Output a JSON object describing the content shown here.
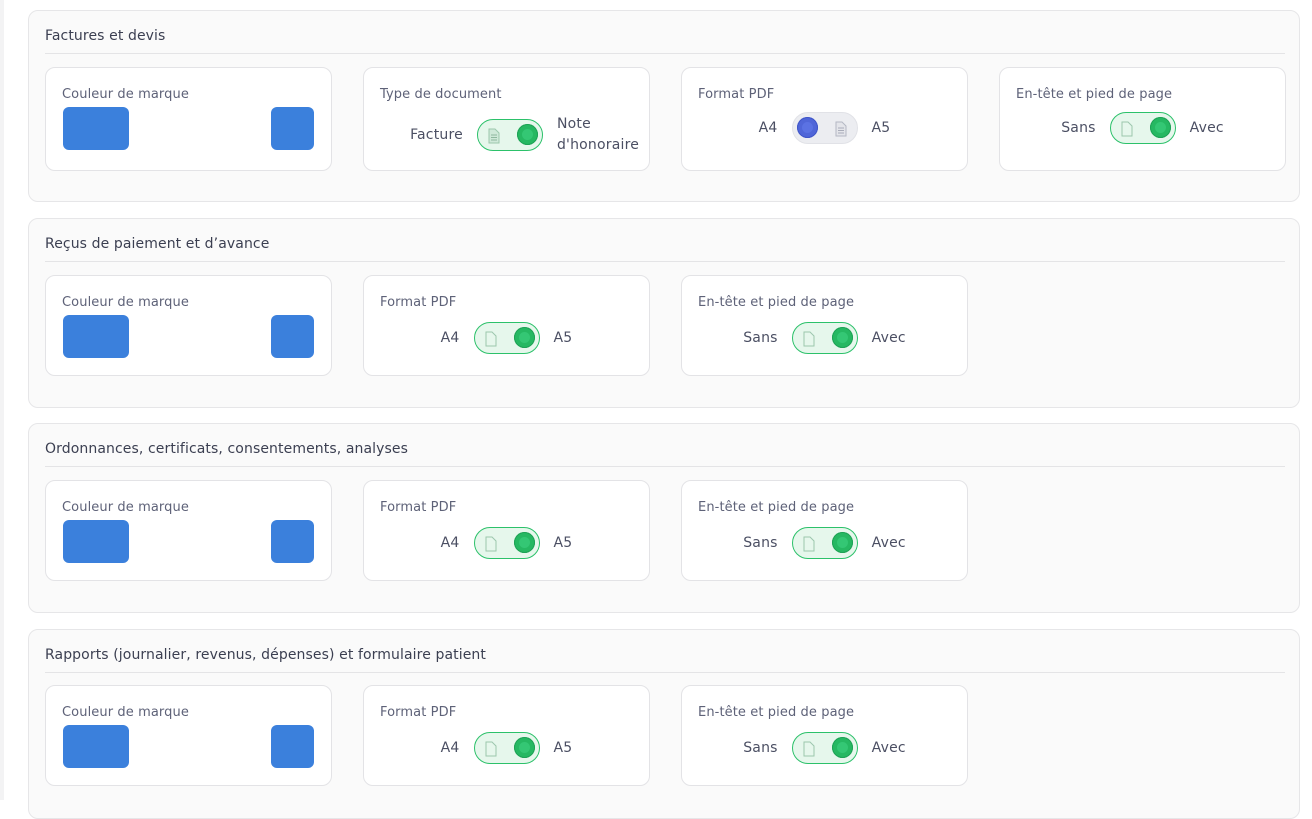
{
  "colors": {
    "brand_swatch": "#3b80dc",
    "toggle_on": "#26b862",
    "toggle_off_knob": "#5066d8"
  },
  "sections": [
    {
      "title": "Factures et devis",
      "brand": {
        "label": "Couleur de marque"
      },
      "doc_type": {
        "label": "Type de document",
        "left": "Facture",
        "right": "Note d'honoraire",
        "state": "right"
      },
      "pdf": {
        "label": "Format PDF",
        "left": "A4",
        "right": "A5",
        "state": "left"
      },
      "header": {
        "label": "En-tête et pied de page",
        "left": "Sans",
        "right": "Avec",
        "state": "right"
      }
    },
    {
      "title": "Reçus de paiement et d’avance",
      "brand": {
        "label": "Couleur de marque"
      },
      "pdf": {
        "label": "Format PDF",
        "left": "A4",
        "right": "A5",
        "state": "right"
      },
      "header": {
        "label": "En-tête et pied de page",
        "left": "Sans",
        "right": "Avec",
        "state": "right"
      }
    },
    {
      "title": "Ordonnances, certificats, consentements, analyses",
      "brand": {
        "label": "Couleur de marque"
      },
      "pdf": {
        "label": "Format PDF",
        "left": "A4",
        "right": "A5",
        "state": "right"
      },
      "header": {
        "label": "En-tête et pied de page",
        "left": "Sans",
        "right": "Avec",
        "state": "right"
      }
    },
    {
      "title": "Rapports (journalier, revenus, dépenses) et formulaire patient",
      "brand": {
        "label": "Couleur de marque"
      },
      "pdf": {
        "label": "Format PDF",
        "left": "A4",
        "right": "A5",
        "state": "right"
      },
      "header": {
        "label": "En-tête et pied de page",
        "left": "Sans",
        "right": "Avec",
        "state": "right"
      }
    }
  ]
}
